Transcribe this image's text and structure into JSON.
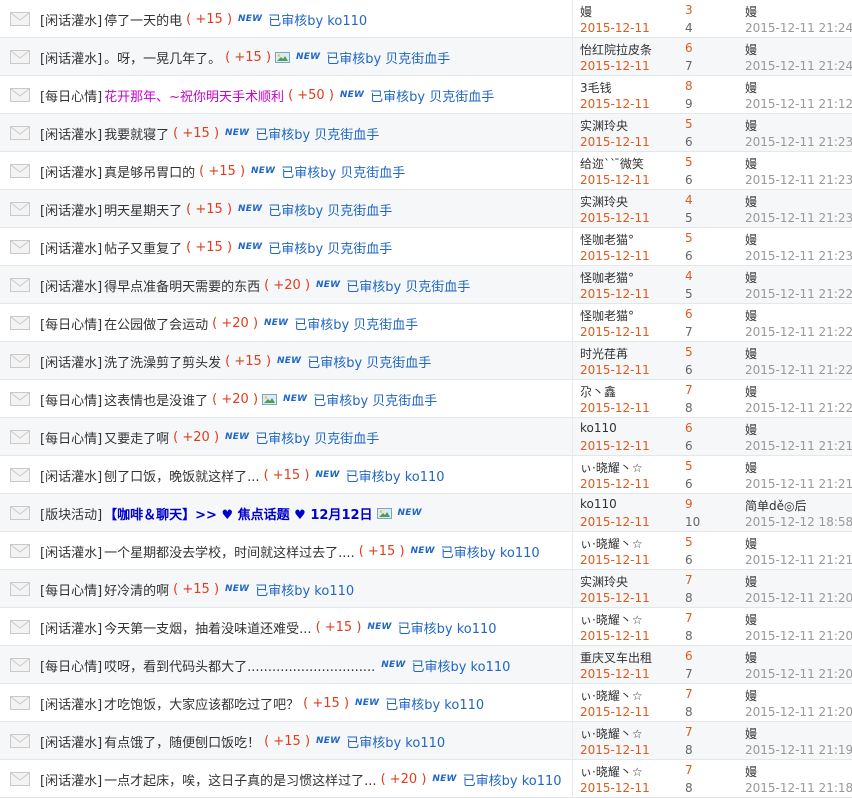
{
  "colors": {
    "credit": "#e23c1d",
    "link": "#2167c5",
    "date": "#e05a1c",
    "pink_title": "#cc00cc",
    "bold_title": "#0000cc"
  },
  "icons": {
    "row": "envelope-icon",
    "attachment": "image-attachment-icon"
  },
  "threads": [
    {
      "category": "[闲话灌水]",
      "title": "停了一天的电",
      "style": "normal",
      "credit": "( +15 )",
      "img": false,
      "new": "NEW",
      "audit": "已审核by ko110",
      "author": "嫚",
      "date": "2015-12-11",
      "replies": "3",
      "views": "4",
      "last_user": "嫚",
      "last_time": "2015-12-11 21:24"
    },
    {
      "category": "[闲话灌水]",
      "title": "。呀，一晃几年了。",
      "style": "normal",
      "credit": "( +15 )",
      "img": true,
      "new": "NEW",
      "audit": "已审核by 贝克街血手",
      "author": "怡红院拉皮条",
      "date": "2015-12-11",
      "replies": "6",
      "views": "7",
      "last_user": "嫚",
      "last_time": "2015-12-11 21:24"
    },
    {
      "category": "[每日心情]",
      "title": "花开那年、~祝你明天手术顺利",
      "style": "pink",
      "credit": "( +50 )",
      "img": false,
      "new": "NEW",
      "audit": "已审核by 贝克街血手",
      "author": "3毛钱",
      "date": "2015-12-11",
      "replies": "8",
      "views": "9",
      "last_user": "嫚",
      "last_time": "2015-12-11 21:12"
    },
    {
      "category": "[闲话灌水]",
      "title": "我要就寝了",
      "style": "normal",
      "credit": "( +15 )",
      "img": false,
      "new": "NEW",
      "audit": "已审核by 贝克街血手",
      "author": "实渊玲央",
      "date": "2015-12-11",
      "replies": "5",
      "views": "6",
      "last_user": "嫚",
      "last_time": "2015-12-11 21:23"
    },
    {
      "category": "[闲话灌水]",
      "title": "真是够吊胃口的",
      "style": "normal",
      "credit": "( +15 )",
      "img": false,
      "new": "NEW",
      "audit": "已审核by 贝克街血手",
      "author": "给迩`` ̄微笑",
      "date": "2015-12-11",
      "replies": "5",
      "views": "6",
      "last_user": "嫚",
      "last_time": "2015-12-11 21:23"
    },
    {
      "category": "[闲话灌水]",
      "title": "明天星期天了",
      "style": "normal",
      "credit": "( +15 )",
      "img": false,
      "new": "NEW",
      "audit": "已审核by 贝克街血手",
      "author": "实渊玲央",
      "date": "2015-12-11",
      "replies": "4",
      "views": "5",
      "last_user": "嫚",
      "last_time": "2015-12-11 21:23"
    },
    {
      "category": "[闲话灌水]",
      "title": "帖子又重复了",
      "style": "normal",
      "credit": "( +15 )",
      "img": false,
      "new": "NEW",
      "audit": "已审核by 贝克街血手",
      "author": "怪咖老猫°",
      "date": "2015-12-11",
      "replies": "5",
      "views": "6",
      "last_user": "嫚",
      "last_time": "2015-12-11 21:23"
    },
    {
      "category": "[闲话灌水]",
      "title": "得早点准备明天需要的东西",
      "style": "normal",
      "credit": "( +20 )",
      "img": false,
      "new": "NEW",
      "audit": "已审核by 贝克街血手",
      "author": "怪咖老猫°",
      "date": "2015-12-11",
      "replies": "4",
      "views": "5",
      "last_user": "嫚",
      "last_time": "2015-12-11 21:22"
    },
    {
      "category": "[每日心情]",
      "title": "在公园做了会运动",
      "style": "normal",
      "credit": "( +20 )",
      "img": false,
      "new": "NEW",
      "audit": "已审核by 贝克街血手",
      "author": "怪咖老猫°",
      "date": "2015-12-11",
      "replies": "6",
      "views": "7",
      "last_user": "嫚",
      "last_time": "2015-12-11 21:22"
    },
    {
      "category": "[闲话灌水]",
      "title": "洗了洗澡剪了剪头发",
      "style": "normal",
      "credit": "( +15 )",
      "img": false,
      "new": "NEW",
      "audit": "已审核by 贝克街血手",
      "author": "时光荏苒",
      "date": "2015-12-11",
      "replies": "5",
      "views": "6",
      "last_user": "嫚",
      "last_time": "2015-12-11 21:22"
    },
    {
      "category": "[每日心情]",
      "title": "这表情也是没谁了",
      "style": "normal",
      "credit": "( +20 )",
      "img": true,
      "new": "NEW",
      "audit": "已审核by 贝克街血手",
      "author": "尕丶鑫",
      "date": "2015-12-11",
      "replies": "7",
      "views": "8",
      "last_user": "嫚",
      "last_time": "2015-12-11 21:22"
    },
    {
      "category": "[每日心情]",
      "title": "又要走了啊",
      "style": "normal",
      "credit": "( +20 )",
      "img": false,
      "new": "NEW",
      "audit": "已审核by 贝克街血手",
      "author": "ko110",
      "date": "2015-12-11",
      "replies": "6",
      "views": "6",
      "last_user": "嫚",
      "last_time": "2015-12-11 21:21"
    },
    {
      "category": "[闲话灌水]",
      "title": "刨了口饭，晚饭就这样了...",
      "style": "normal",
      "credit": "( +15 )",
      "img": false,
      "new": "NEW",
      "audit": "已审核by ko110",
      "author": "ぃ·晓耀丶☆",
      "date": "2015-12-11",
      "replies": "5",
      "views": "6",
      "last_user": "嫚",
      "last_time": "2015-12-11 21:21"
    },
    {
      "category": "[版块活动]",
      "title": "【咖啡＆聊天】>> ♥ 焦点话题 ♥ 12月12日",
      "style": "bold",
      "credit": "",
      "img": true,
      "new": "NEW",
      "audit": "",
      "author": "ko110",
      "date": "2015-12-11",
      "replies": "9",
      "views": "10",
      "last_user": "简单dě◎后",
      "last_time": "2015-12-12 18:58"
    },
    {
      "category": "[闲话灌水]",
      "title": "一个星期都没去学校，时间就这样过去了....",
      "style": "normal",
      "credit": "( +15 )",
      "img": false,
      "new": "NEW",
      "audit": "已审核by ko110",
      "author": "ぃ·晓耀丶☆",
      "date": "2015-12-11",
      "replies": "5",
      "views": "6",
      "last_user": "嫚",
      "last_time": "2015-12-11 21:21"
    },
    {
      "category": "[每日心情]",
      "title": "好冷清的啊",
      "style": "normal",
      "credit": "( +15 )",
      "img": false,
      "new": "NEW",
      "audit": "已审核by ko110",
      "author": "实渊玲央",
      "date": "2015-12-11",
      "replies": "7",
      "views": "8",
      "last_user": "嫚",
      "last_time": "2015-12-11 21:20"
    },
    {
      "category": "[闲话灌水]",
      "title": "今天第一支烟，抽着没味道还难受...",
      "style": "normal",
      "credit": "( +15 )",
      "img": false,
      "new": "NEW",
      "audit": "已审核by ko110",
      "author": "ぃ·晓耀丶☆",
      "date": "2015-12-11",
      "replies": "7",
      "views": "8",
      "last_user": "嫚",
      "last_time": "2015-12-11 21:20"
    },
    {
      "category": "[每日心情]",
      "title": "哎呀，看到代码头都大了...............................",
      "style": "normal",
      "credit": "",
      "img": false,
      "new": "NEW",
      "audit": "已审核by ko110",
      "author": "重庆叉车出租",
      "date": "2015-12-11",
      "replies": "6",
      "views": "7",
      "last_user": "嫚",
      "last_time": "2015-12-11 21:20"
    },
    {
      "category": "[闲话灌水]",
      "title": "才吃饱饭，大家应该都吃过了吧？",
      "style": "normal",
      "credit": "( +15 )",
      "img": false,
      "new": "NEW",
      "audit": "已审核by ko110",
      "author": "ぃ·晓耀丶☆",
      "date": "2015-12-11",
      "replies": "7",
      "views": "8",
      "last_user": "嫚",
      "last_time": "2015-12-11 21:20"
    },
    {
      "category": "[闲话灌水]",
      "title": "有点饿了，随便刨口饭吃！",
      "style": "normal",
      "credit": "( +15 )",
      "img": false,
      "new": "NEW",
      "audit": "已审核by ko110",
      "author": "ぃ·晓耀丶☆",
      "date": "2015-12-11",
      "replies": "7",
      "views": "8",
      "last_user": "嫚",
      "last_time": "2015-12-11 21:19"
    },
    {
      "category": "[闲话灌水]",
      "title": "一点才起床，唉，这日子真的是习惯这样过了...",
      "style": "normal",
      "credit": "( +20 )",
      "img": false,
      "new": "NEW",
      "audit": "已审核by ko110",
      "author": "ぃ·晓耀丶☆",
      "date": "2015-12-11",
      "replies": "7",
      "views": "8",
      "last_user": "嫚",
      "last_time": "2015-12-11 21:18"
    }
  ]
}
